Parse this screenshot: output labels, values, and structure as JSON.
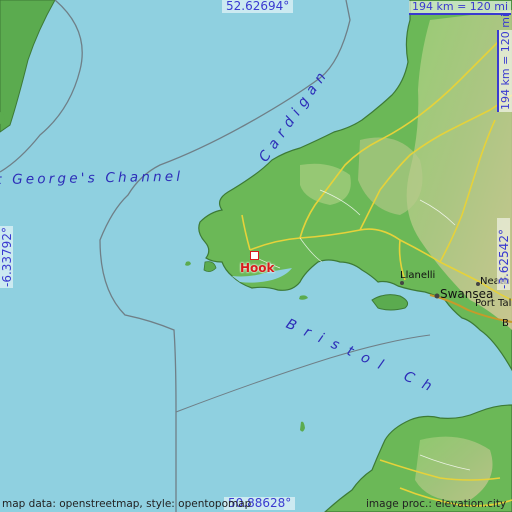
{
  "map": {
    "coords": {
      "top": "52.62694°",
      "bottom": "50.88628°",
      "left": "-6.33792°",
      "right": "-3.62542°"
    },
    "scale_horizontal": "194 km = 120 mi",
    "scale_vertical": "194 km = 120 mi",
    "attribution_left": "map data: openstreetmap, style: opentopomap",
    "attribution_right": "image proc.: elevation.city",
    "sea_labels": {
      "st_georges": "t George's Channel",
      "cardigan": "Cardigan",
      "bristol": "Bristol Ch"
    },
    "place": {
      "name": "Hook"
    },
    "towns": {
      "llanelli": "Llanelli",
      "swansea": "Swansea",
      "neath": "Neath",
      "port_talbot": "Port Talbot",
      "cardiff_partial": "B"
    },
    "colors": {
      "sea": "#8fd0e0",
      "lowland": "#5bab4f",
      "highland": "#c8c08a",
      "road": "#e6d23a",
      "marker": "#d81c1c"
    }
  }
}
